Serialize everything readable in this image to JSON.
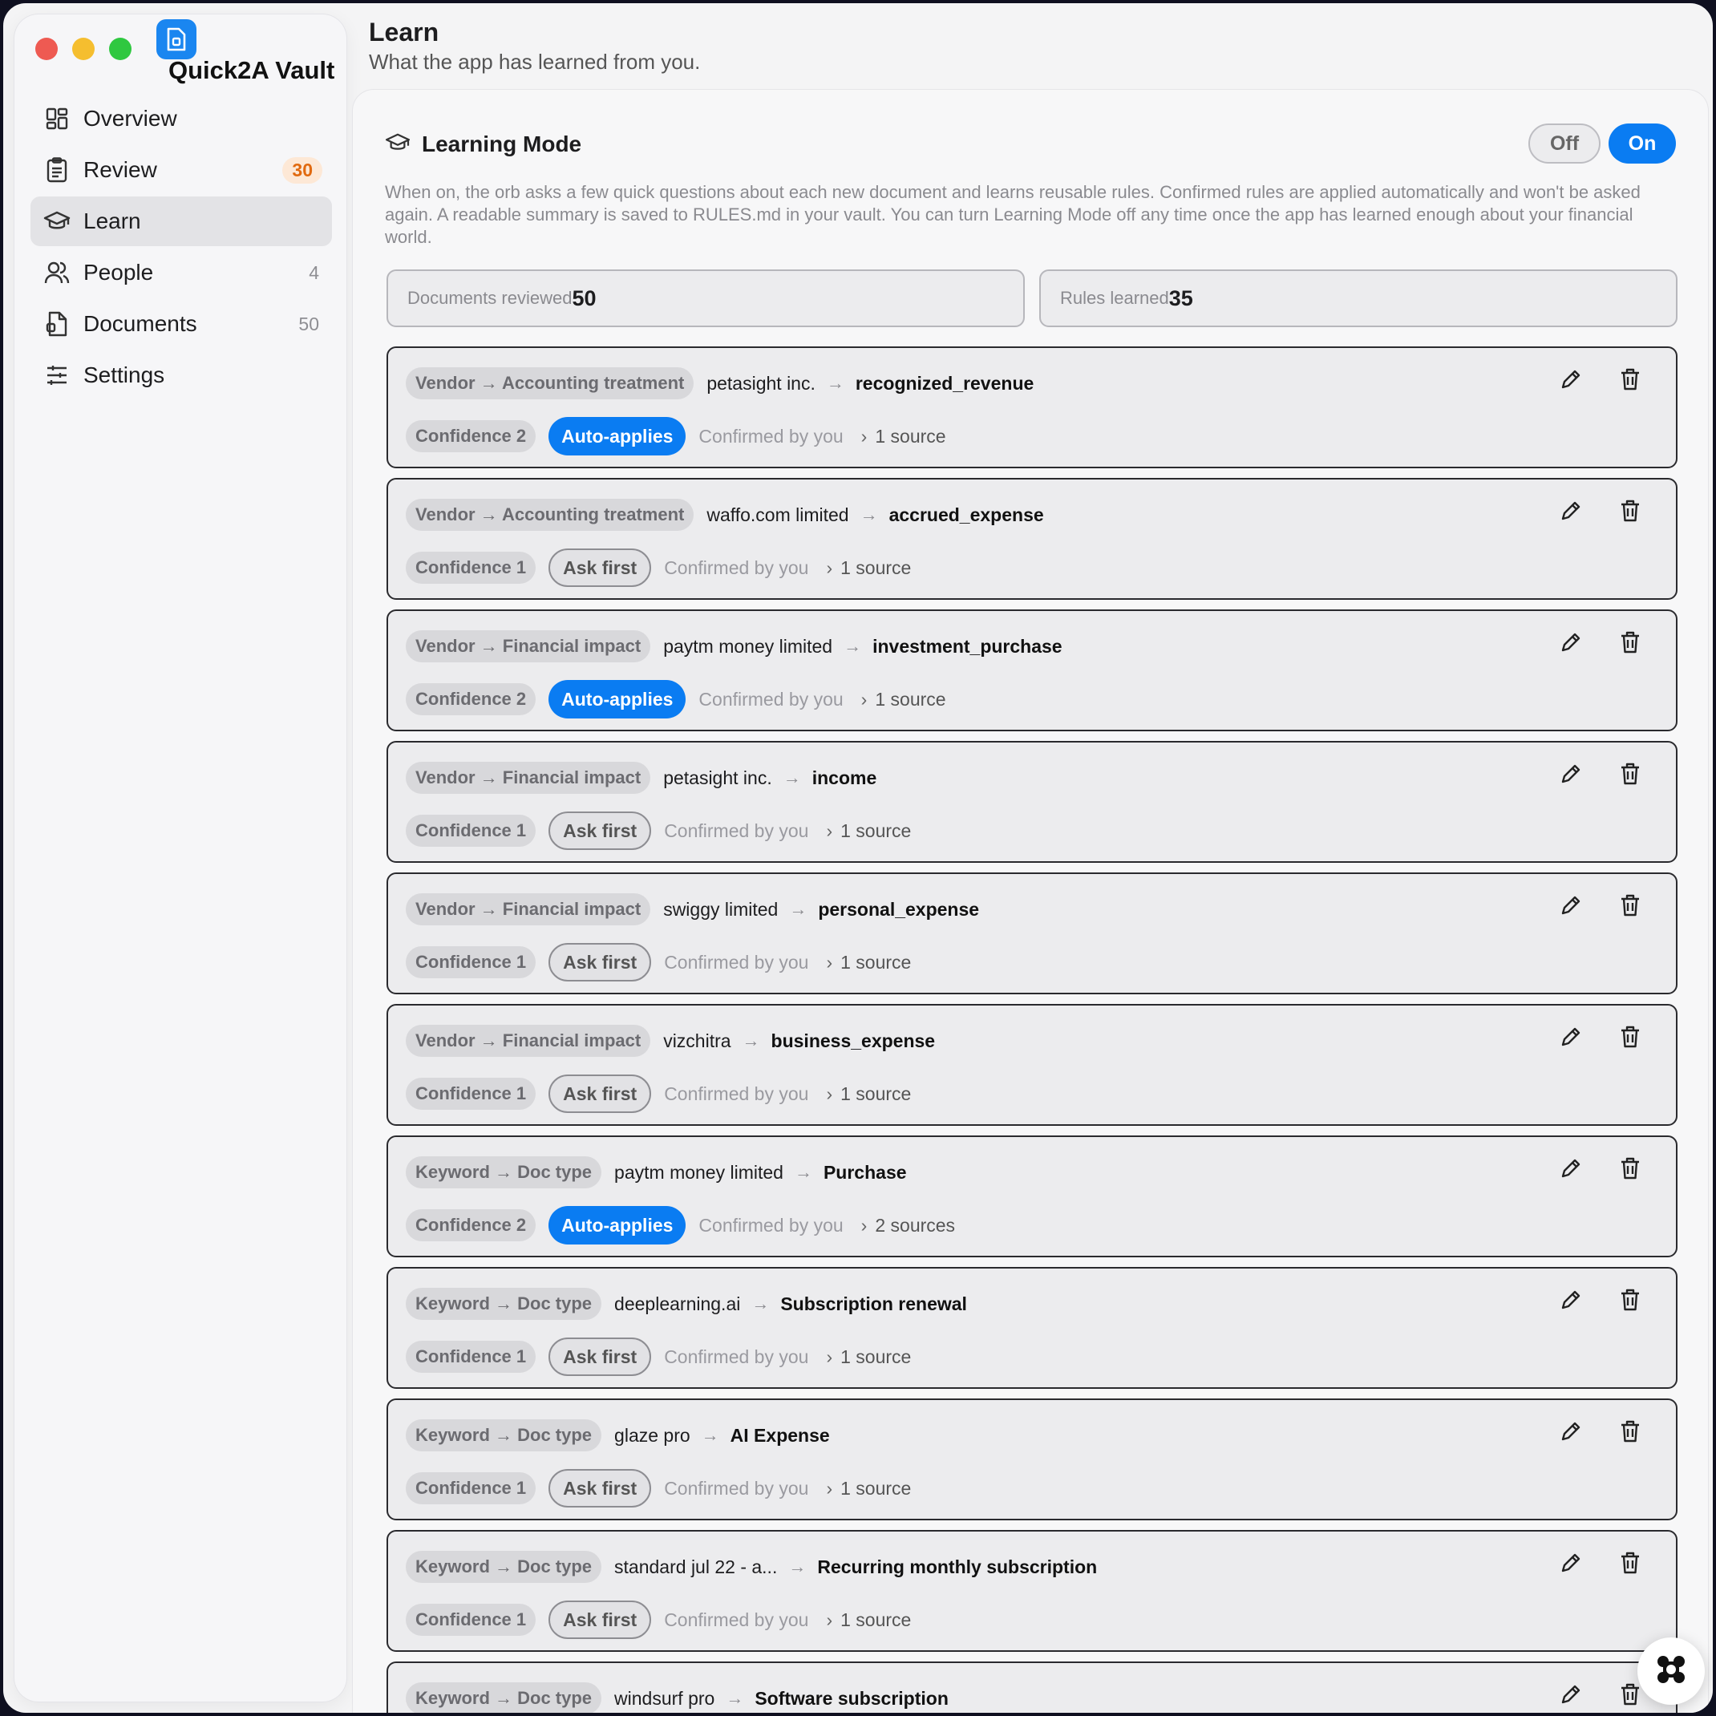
{
  "app": {
    "name": "Quick2A Vault"
  },
  "sidebar": {
    "items": [
      {
        "label": "Overview",
        "icon": "grid-icon",
        "count": ""
      },
      {
        "label": "Review",
        "icon": "clipboard-icon",
        "count": "30"
      },
      {
        "label": "Learn",
        "icon": "graduation-cap-icon",
        "count": ""
      },
      {
        "label": "People",
        "icon": "people-icon",
        "count": "4"
      },
      {
        "label": "Documents",
        "icon": "document-icon",
        "count": "50"
      },
      {
        "label": "Settings",
        "icon": "sliders-icon",
        "count": ""
      }
    ]
  },
  "header": {
    "title": "Learn",
    "subtitle": "What the app has learned from you."
  },
  "learning_mode": {
    "title": "Learning Mode",
    "off_label": "Off",
    "on_label": "On",
    "state": "On",
    "description": "When on, the orb asks a few quick questions about each new document and learns reusable rules. Confirmed rules are applied automatically and won't be asked again. A readable summary is saved to RULES.md in your vault. You can turn Learning Mode off any time once the app has learned enough about your financial world."
  },
  "stats": {
    "docs_label": "Documents reviewed",
    "docs_value": "50",
    "rules_label": "Rules learned",
    "rules_value": "35"
  },
  "rules": [
    {
      "type": "Vendor → Accounting treatment",
      "key": "petasight inc.",
      "value": "recognized_revenue",
      "confidence": "Confidence 2",
      "mode": "Auto-applies",
      "confirmed": "Confirmed by you",
      "sources": "1 source"
    },
    {
      "type": "Vendor → Accounting treatment",
      "key": "waffo.com limited",
      "value": "accrued_expense",
      "confidence": "Confidence 1",
      "mode": "Ask first",
      "confirmed": "Confirmed by you",
      "sources": "1 source"
    },
    {
      "type": "Vendor → Financial impact",
      "key": "paytm money limited",
      "value": "investment_purchase",
      "confidence": "Confidence 2",
      "mode": "Auto-applies",
      "confirmed": "Confirmed by you",
      "sources": "1 source"
    },
    {
      "type": "Vendor → Financial impact",
      "key": "petasight inc.",
      "value": "income",
      "confidence": "Confidence 1",
      "mode": "Ask first",
      "confirmed": "Confirmed by you",
      "sources": "1 source"
    },
    {
      "type": "Vendor → Financial impact",
      "key": "swiggy limited",
      "value": "personal_expense",
      "confidence": "Confidence 1",
      "mode": "Ask first",
      "confirmed": "Confirmed by you",
      "sources": "1 source"
    },
    {
      "type": "Vendor → Financial impact",
      "key": "vizchitra",
      "value": "business_expense",
      "confidence": "Confidence 1",
      "mode": "Ask first",
      "confirmed": "Confirmed by you",
      "sources": "1 source"
    },
    {
      "type": "Keyword → Doc type",
      "key": "paytm money limited",
      "value": "Purchase",
      "confidence": "Confidence 2",
      "mode": "Auto-applies",
      "confirmed": "Confirmed by you",
      "sources": "2 sources"
    },
    {
      "type": "Keyword → Doc type",
      "key": "deeplearning.ai",
      "value": "Subscription renewal",
      "confidence": "Confidence 1",
      "mode": "Ask first",
      "confirmed": "Confirmed by you",
      "sources": "1 source"
    },
    {
      "type": "Keyword → Doc type",
      "key": "glaze pro",
      "value": "AI Expense",
      "confidence": "Confidence 1",
      "mode": "Ask first",
      "confirmed": "Confirmed by you",
      "sources": "1 source"
    },
    {
      "type": "Keyword → Doc type",
      "key": "standard jul 22 - a...",
      "value": "Recurring monthly subscription",
      "confidence": "Confidence 1",
      "mode": "Ask first",
      "confirmed": "Confirmed by you",
      "sources": "1 source"
    },
    {
      "type": "Keyword → Doc type",
      "key": "windsurf pro",
      "value": "Software subscription",
      "confidence": "",
      "mode": "",
      "confirmed": "",
      "sources": ""
    }
  ],
  "colors": {
    "accent": "#0a7cf2",
    "badge_bg": "#fde8d6",
    "badge_fg": "#e16a10"
  }
}
